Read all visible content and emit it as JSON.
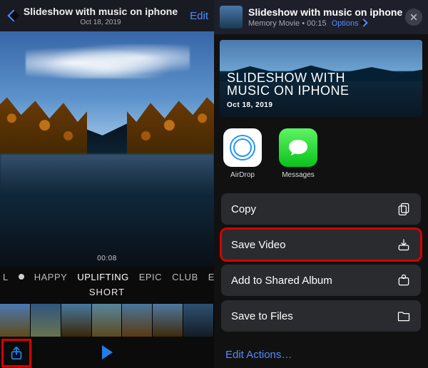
{
  "left": {
    "header": {
      "title": "Slideshow with music on iphone",
      "subtitle": "Oct 18, 2019",
      "edit": "Edit"
    },
    "elapsed": "00:08",
    "moods": {
      "items": [
        "L",
        "HAPPY",
        "UPLIFTING",
        "EPIC",
        "CLUB",
        "EX"
      ],
      "active_index": 2
    },
    "length_label": "SHORT"
  },
  "right": {
    "header": {
      "title": "Slideshow with music on iphone",
      "kind": "Memory Movie",
      "duration": "00:15",
      "options": "Options"
    },
    "preview": {
      "line1": "SLIDESHOW WITH",
      "line2": "MUSIC ON IPHONE",
      "date": "Oct 18, 2019"
    },
    "apps": [
      {
        "label": "AirDrop"
      },
      {
        "label": "Messages"
      }
    ],
    "actions": [
      {
        "label": "Copy",
        "icon": "copy"
      },
      {
        "label": "Save Video",
        "icon": "download",
        "highlight": true
      },
      {
        "label": "Add to Shared Album",
        "icon": "shared-album"
      },
      {
        "label": "Save to Files",
        "icon": "folder"
      }
    ],
    "edit_actions": "Edit Actions…"
  }
}
